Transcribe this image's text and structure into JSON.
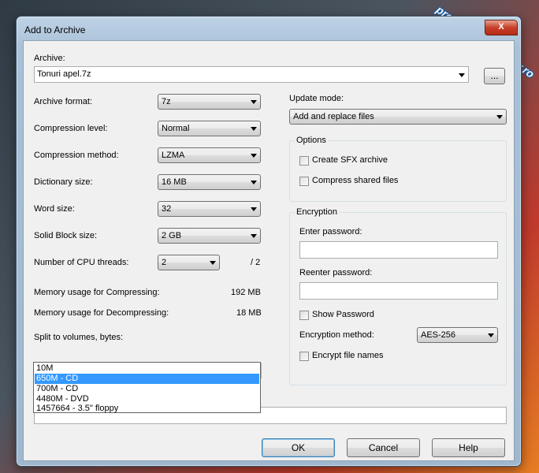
{
  "window": {
    "title": "Add to Archive",
    "close_label": "X"
  },
  "watermark": "programecalculator.ro",
  "archive": {
    "label": "Archive:",
    "value": "Tonuri apel.7z",
    "browse_label": "..."
  },
  "left": {
    "archive_format": {
      "label": "Archive format:",
      "value": "7z"
    },
    "compression_level": {
      "label": "Compression level:",
      "value": "Normal"
    },
    "compression_method": {
      "label": "Compression method:",
      "value": "LZMA"
    },
    "dictionary_size": {
      "label": "Dictionary size:",
      "value": "16 MB"
    },
    "word_size": {
      "label": "Word size:",
      "value": "32"
    },
    "solid_block_size": {
      "label": "Solid Block size:",
      "value": "2 GB"
    },
    "cpu_threads": {
      "label": "Number of CPU threads:",
      "value": "2",
      "max": "/ 2"
    },
    "mem_compress": {
      "label": "Memory usage for Compressing:",
      "value": "192 MB"
    },
    "mem_decompress": {
      "label": "Memory usage for Decompressing:",
      "value": "18 MB"
    },
    "split": {
      "label": "Split to volumes, bytes:",
      "value": "",
      "options": [
        "10M",
        "650M - CD",
        "700M - CD",
        "4480M - DVD",
        "1457664 - 3.5\" floppy"
      ],
      "highlighted_index": 1
    }
  },
  "right": {
    "update_mode": {
      "label": "Update mode:",
      "value": "Add and replace files"
    },
    "options": {
      "title": "Options",
      "create_sfx": {
        "label": "Create SFX archive",
        "checked": false
      },
      "compress_shared": {
        "label": "Compress shared files",
        "checked": false
      }
    },
    "encryption": {
      "title": "Encryption",
      "enter_password_label": "Enter password:",
      "reenter_password_label": "Reenter password:",
      "show_password": {
        "label": "Show Password",
        "checked": false
      },
      "method_label": "Encryption method:",
      "method_value": "AES-256",
      "encrypt_names": {
        "label": "Encrypt file names",
        "checked": false
      }
    }
  },
  "buttons": {
    "ok": "OK",
    "cancel": "Cancel",
    "help": "Help"
  }
}
